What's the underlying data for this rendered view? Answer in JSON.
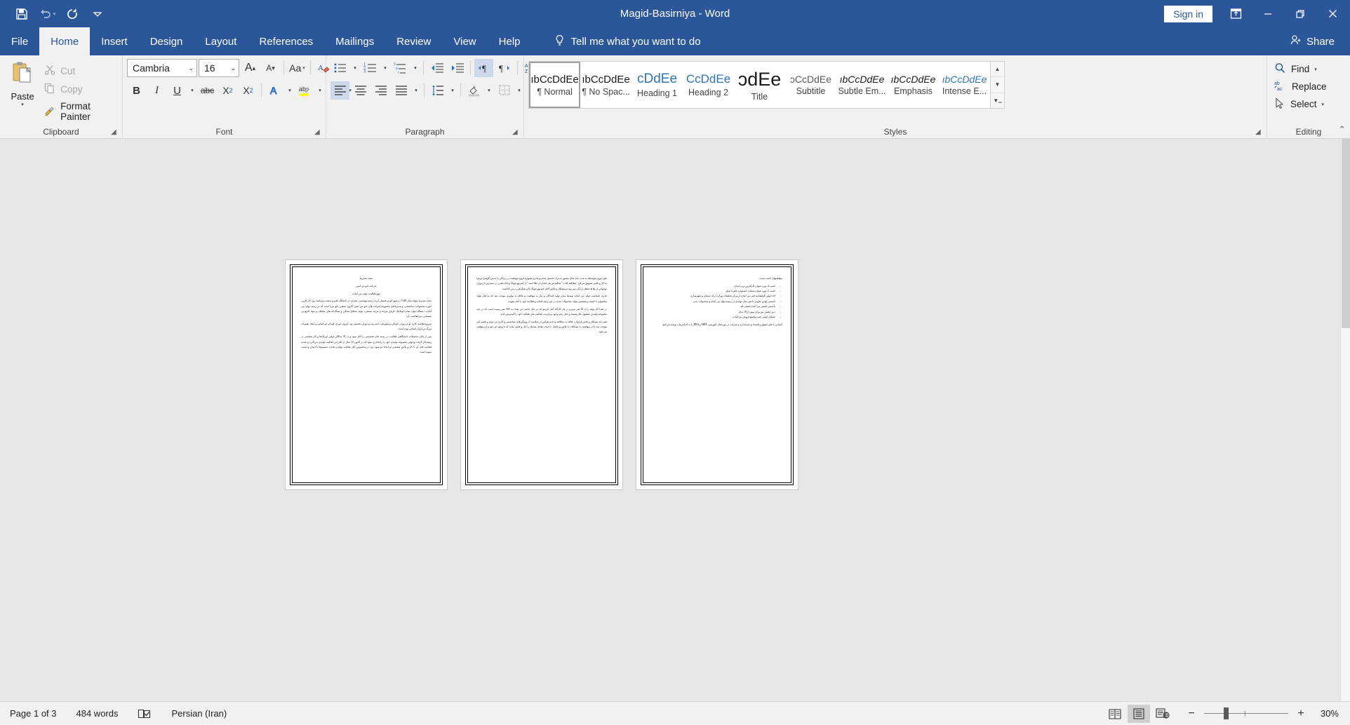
{
  "titlebar": {
    "document_title": "Magid-Basirniya  -  Word",
    "quick_access": [
      {
        "name": "save-icon",
        "label": "Save"
      },
      {
        "name": "undo-icon",
        "label": "Undo"
      },
      {
        "name": "redo-icon",
        "label": "Redo"
      },
      {
        "name": "customize-quick-access-icon",
        "label": "Customize Quick Access Toolbar"
      }
    ],
    "sign_in": "Sign in",
    "window_buttons": [
      {
        "name": "ribbon-display-options-icon",
        "label": "Ribbon Display Options"
      },
      {
        "name": "minimize-icon",
        "label": "Minimize"
      },
      {
        "name": "restore-icon",
        "label": "Restore Down"
      },
      {
        "name": "close-icon",
        "label": "Close"
      }
    ]
  },
  "tabs": [
    {
      "label": "File",
      "active": false
    },
    {
      "label": "Home",
      "active": true
    },
    {
      "label": "Insert",
      "active": false
    },
    {
      "label": "Design",
      "active": false
    },
    {
      "label": "Layout",
      "active": false
    },
    {
      "label": "References",
      "active": false
    },
    {
      "label": "Mailings",
      "active": false
    },
    {
      "label": "Review",
      "active": false
    },
    {
      "label": "View",
      "active": false
    },
    {
      "label": "Help",
      "active": false
    }
  ],
  "tell_me": "Tell me what you want to do",
  "share": "Share",
  "ribbon": {
    "clipboard": {
      "group_label": "Clipboard",
      "paste": "Paste",
      "cut": "Cut",
      "copy": "Copy",
      "format_painter": "Format Painter"
    },
    "font": {
      "group_label": "Font",
      "font_name": "Cambria",
      "font_size": "16",
      "buttons": [
        "Grow Font",
        "Shrink Font",
        "Change Case",
        "Clear All Formatting",
        "Bold",
        "Italic",
        "Underline",
        "Strikethrough",
        "Subscript",
        "Superscript",
        "Text Effects and Typography",
        "Text Highlight Color",
        "Font Color"
      ]
    },
    "paragraph": {
      "group_label": "Paragraph",
      "buttons": [
        "Bullets",
        "Numbering",
        "Multilevel List",
        "Decrease Indent",
        "Increase Indent",
        "Left-to-Right Text Direction",
        "Right-to-Left Text Direction",
        "Sort",
        "Show/Hide Formatting Marks",
        "Align Left",
        "Center",
        "Align Right",
        "Justify",
        "Line and Paragraph Spacing",
        "Shading",
        "Borders"
      ]
    },
    "styles": {
      "group_label": "Styles",
      "items": [
        {
          "preview": "ıbCcDdEe",
          "name": "¶ Normal",
          "selected": true,
          "color": "#1a1a1a",
          "size": "15px",
          "style": "normal"
        },
        {
          "preview": "ıbCcDdEe",
          "name": "¶ No Spac...",
          "selected": false,
          "color": "#1a1a1a",
          "size": "15px",
          "style": "normal"
        },
        {
          "preview": "cDdEe",
          "name": "Heading 1",
          "selected": false,
          "color": "#2e74b5",
          "size": "19px",
          "style": "normal"
        },
        {
          "preview": "CcDdEe",
          "name": "Heading 2",
          "selected": false,
          "color": "#2e74b5",
          "size": "17px",
          "style": "normal"
        },
        {
          "preview": "ɔdEe",
          "name": "Title",
          "selected": false,
          "color": "#1a1a1a",
          "size": "27px",
          "style": "normal"
        },
        {
          "preview": "ɔCcDdEe",
          "name": "Subtitle",
          "selected": false,
          "color": "#595959",
          "size": "14px",
          "style": "normal"
        },
        {
          "preview": "ıbCcDdEe",
          "name": "Subtle Em...",
          "selected": false,
          "color": "#1a1a1a",
          "size": "14px",
          "style": "italic"
        },
        {
          "preview": "ıbCcDdEe",
          "name": "Emphasis",
          "selected": false,
          "color": "#1a1a1a",
          "size": "14px",
          "style": "italic"
        },
        {
          "preview": "ıbCcDdEe",
          "name": "Intense E...",
          "selected": false,
          "color": "#2e74b5",
          "size": "14px",
          "style": "italic"
        }
      ]
    },
    "editing": {
      "group_label": "Editing",
      "find": "Find",
      "replace": "Replace",
      "select": "Select"
    }
  },
  "document": {
    "pages": [
      {
        "page_number": 1,
        "blocks": [
          {
            "type": "p",
            "align": "center",
            "text": "مجید بصیرنیا"
          },
          {
            "type": "p",
            "align": "center",
            "text": "شرکت نانو بتن امین"
          },
          {
            "type": "p",
            "align": "center",
            "text": "نوع فعالیت: تولید بتن آماده"
          },
          {
            "type": "p",
            "align": "justify",
            "text": "مجید بصیرنیا متولد سال 1348 در شهر قم و تحصیل کرده رشته مهندسی عمران در دانشگاه علم و صنعت می‌باشد. وی کار آفرین حوزه محصولات ساختمانی و مدیرعامل مجموعه شرکت های نانو بتن امین (گروه صنعتی نانو بتن) است که در زمینه تولید بتن آماده، دستگاه تولید تمام اتوماتیک خرپای تیرچه و تیرچه صنعتی، تولید مصالح سنگی و سنگدانه های مختلف و مواد افزودنی شیمیایی بتن فعالیت دارد."
          },
          {
            "type": "p",
            "align": "justify",
            "text": "شروع فعالیت کاری او از دوران کودکی و همزمان با مدرسه و دوران تحصیل بود. آرزوی دوران کودکی او خلبانی و ایجاد تغییرات بزرگ در ایران انسانی بوده است."
          },
          {
            "type": "p",
            "align": "justify",
            "text": "پس از پایان تحصیلات دانشگاهی فعالیت در زمینه های تخصصی را آغاز نمود و در 35 سالگی اولین اورنگ‌ها و کار شخصی در ریشه‌کار گرفت و اولین مجموعه تولیدی خود را راه‌اندازی نمود که در کانون 13 سال از آغاز این فعالیت تولیدی می‌گذرد و عمده فعالیت های آن با کار و تلاش شخصی او ایجاد می‌شود. وی در مخصوص آغاز فعالیت تولیدی هدف، تصمیم‌ها با ایمان و امنیت نموده است."
          }
        ]
      },
      {
        "page_number": 2,
        "blocks": [
          {
            "type": "p",
            "align": "justify",
            "text": "طی دوره متوسطه به مدت سه سال مجبور به ترک تحصیل شدم و مادرم همواره لزوم موفقیت در زندگی را به من گوشزد و مرا به کار و تلاش تشویق می‌کرد. مطالعه کتاب \"سنگفرش هر خیابان از طلا است\" از کیم وو چونگ و کتاب‌هایی در دسترس از دوران نوجوانی از نقاط عطف زندگی من بوده و پشتکار و تلاش آقای کیم وو چونگ تأثیر شگرفی بر من گذاشت."
          },
          {
            "type": "p",
            "align": "justify",
            "text": "تجربه نامناسب تولید بتن آماده توسط سایر تولید کنندگان و نیاز به موفقیت و علاقه به نوآوری موجب شد که به فکر تولید محصولی با کیفیت و همچنین تولید محصولات جدید در این زمینه افتاده و فعالیت خود را آغاز نمودم."
          },
          {
            "type": "p",
            "align": "justify",
            "text": "در ابتدا کار تولید را با 10 نفر نیرو و در یک کارگاه آغاز کردیم که در حال حاضر این تعداد به 300 نفر رسیده است که در چند مجموعه تولیدی مشغول بکار هستند و علی رغم وجود مرکزیت، فعالیت ملی فعالیت خود را گسترش دادم."
          },
          {
            "type": "p",
            "align": "justify",
            "text": "همه باید پشتکار و تلاش فراوان، علاقه به مطالعه و عدم هراس از شکست از ویژگی‌های شخصیتی و کاری من بوده و همین امر موجب شد تا در موفقیت با مشکلات با تلاش و تعامل با حرف مقابل مسئله را حل و فصل نماید که با وجود این هم و آن موفقی می‌شود."
          }
        ]
      },
      {
        "page_number": 3,
        "blocks": [
          {
            "type": "p",
            "align": "right",
            "text": "موفقیتهای کسب شده:"
          },
          {
            "type": "ul",
            "items": [
              "کسب 4 دوره عنوان کارآفرین برتر استان",
              "کسب 2 دوره عنوان منتخب جشنواره علم تا عمل",
              "اخذ اولین گواهینامه فنی بتن آماده از مرکز تحقیقات وزارت راه، مسکن و شهرسازی",
              "تأسیس اولین تعاونی دانش بنیان تولیدی در زمینه تولید بتن آماده و محصولات بتنی",
              "تأسیس انجمن بتن آماده استان قم",
              "دبیر انجمن بتن برای بیش از 10 سال",
              "تشکیل اولین دفتر مجتمع فروش بتن آماده"
            ]
          },
          {
            "type": "p",
            "align": "justify",
            "text": "آشنایی با علم حقوق و اقتصاد و حسابداری و شرکت در دوره‌های آموزشی MBA و DBA را به کارآفرینان توصیه می‌کنم."
          }
        ]
      }
    ]
  },
  "statusbar": {
    "page_indicator": "Page 1 of 3",
    "word_count": "484 words",
    "proofing_icon": "proofing-errors-icon",
    "language": "Persian (Iran)",
    "views": [
      {
        "name": "read-mode-view-button",
        "label": "Read Mode",
        "active": false
      },
      {
        "name": "print-layout-view-button",
        "label": "Print Layout",
        "active": true
      },
      {
        "name": "web-layout-view-button",
        "label": "Web Layout",
        "active": false
      }
    ],
    "zoom_out": "−",
    "zoom_in": "+",
    "zoom_level": "30%"
  }
}
